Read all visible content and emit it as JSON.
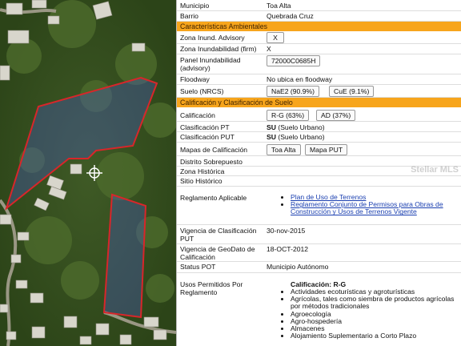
{
  "map": {
    "watermark": "Stellar MLS"
  },
  "rows": {
    "municipio": {
      "label": "Municipio",
      "value": "Toa Alta"
    },
    "barrio": {
      "label": "Barrio",
      "value": "Quebrada Cruz"
    },
    "zona_inund_adv": {
      "label": "Zona Inund. Advisory",
      "button": "X"
    },
    "zona_inund_firm": {
      "label": "Zona Inundabilidad (firm)",
      "value": "X"
    },
    "panel": {
      "label": "Panel Inundabilidad",
      "label2": "(advisory)",
      "button": "72000C0685H"
    },
    "floodway": {
      "label": "Floodway",
      "value": "No ubica en floodway"
    },
    "suelo": {
      "label": "Suelo (NRCS)",
      "button1": "NaE2 (90.9%)",
      "button2": "CuE (9.1%)"
    },
    "calificacion": {
      "label": "Calificación",
      "button1": "R-G (63%)",
      "button2": "AD (37%)"
    },
    "clas_pt": {
      "label": "Clasificación PT",
      "value_bold": "SU",
      "value": " (Suelo Urbano)"
    },
    "clas_put": {
      "label": "Clasificación PUT",
      "value_bold": "SU",
      "value": " (Suelo Urbano)"
    },
    "mapas": {
      "label": "Mapas de Calificación",
      "button1": "Toa Alta",
      "button2": "Mapa PUT"
    },
    "distrito": {
      "label": "Distrito Sobrepuesto"
    },
    "zona_hist": {
      "label": "Zona Histórica"
    },
    "sitio_hist": {
      "label": "Sitio Histórico"
    },
    "reglamento": {
      "label": "Reglamento Aplicable",
      "link1": "Plan de Uso de Terrenos",
      "link2": "Reglamento Conjunto de Permisos para Obras de Construcción y Usos de Terrenos Vigente"
    },
    "vigencia_clas": {
      "label": "Vigencia de Clasificación",
      "label2": "PUT",
      "value": "30-nov-2015"
    },
    "vigencia_geo": {
      "label": "Vigencia de GeoDato de",
      "label2": "Calificación",
      "value": "18-OCT-2012"
    },
    "status_pot": {
      "label": "Status POT",
      "value": "Municipio Autónomo"
    },
    "usos": {
      "label": "Usos Permitidos Por",
      "label2": "Reglamento",
      "heading": "Calificación: R-G",
      "items": [
        "Actividades ecoturísticas y agroturísticas",
        "Agrícolas, tales como siembra de productos agrícolas por métodos tradicionales",
        "Agroecología",
        "Agro-hospedería",
        "Almacenes",
        "Alojamiento Suplementario a Corto Plazo"
      ]
    }
  },
  "sections": {
    "ambientales": "Características Ambientales",
    "calificacion": "Calificación y Clasificación de Suelo"
  }
}
